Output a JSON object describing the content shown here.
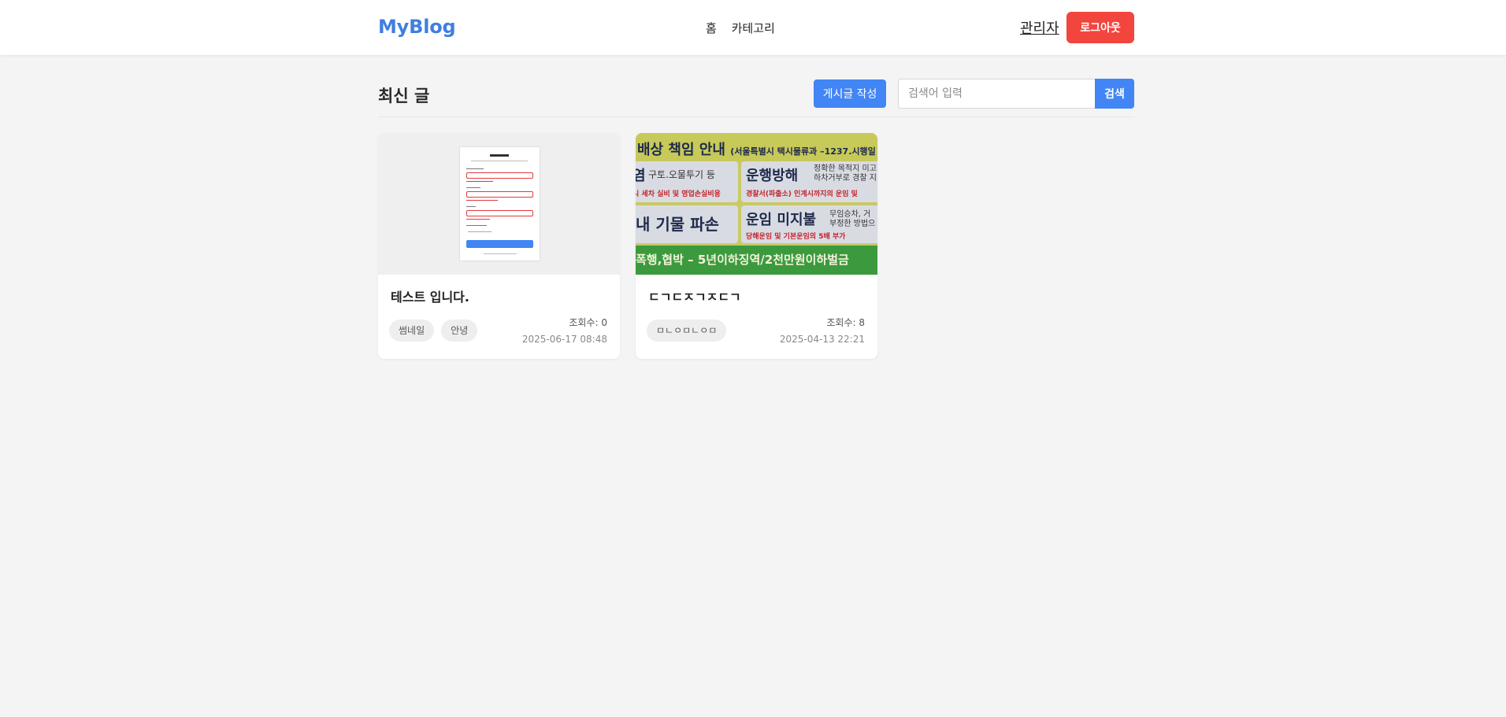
{
  "header": {
    "brand": "MyBlog",
    "nav": [
      {
        "label": "홈"
      },
      {
        "label": "카테고리"
      }
    ],
    "admin_label": "관리자",
    "logout_label": "로그아웃"
  },
  "main": {
    "title": "최신 글",
    "write_button": "게시글 작성",
    "search": {
      "placeholder": "검색어 입력",
      "value": "",
      "button": "검색"
    }
  },
  "posts": [
    {
      "title": "테스트 입니다.",
      "tags": [
        "썸네일",
        "안녕"
      ],
      "views": "조회수: 0",
      "date": "2025-06-17 08:48",
      "thumbnail": "form-screenshot"
    },
    {
      "title": "ㄷㄱㄷㅈㄱㅈㄷㄱ",
      "tags": [
        "ㅁㄴㅇㅁㄴㅇㅁ"
      ],
      "views": "조회수: 8",
      "date": "2025-04-13 22:21",
      "thumbnail": "sign-board-photo",
      "board": {
        "head_main": "배상 책임 안내",
        "head_sub": "(서울특별시 택시물류과 –1237.시행일",
        "panel_a_main": "염",
        "panel_a_sub": "구토.오물투기 등",
        "panel_a_red": "시 세차 실비 및 영업손실비용",
        "panel_b_main": "운행방해",
        "panel_b_sub1": "정확한 목적지 미고",
        "panel_b_sub2": "하차거부로 경찰 지",
        "panel_b_red": "경찰서(파출소) 인계시까지의 운임 및",
        "panel_c_main": "내 기물 파손",
        "panel_d_main": "운임 미지불",
        "panel_d_sub1": "무임승차, 거",
        "panel_d_sub2": "부정한 방법으",
        "panel_d_red": "당해운임 및 기본운임의 5배 부가",
        "foot": "폭행,협박 – 5년이하징역/2천만원이하벌금"
      }
    }
  ],
  "colors": {
    "brand": "#3f7fe0",
    "primary": "#4285f4",
    "logout": "#f2453d",
    "background": "#f4f4f4"
  }
}
